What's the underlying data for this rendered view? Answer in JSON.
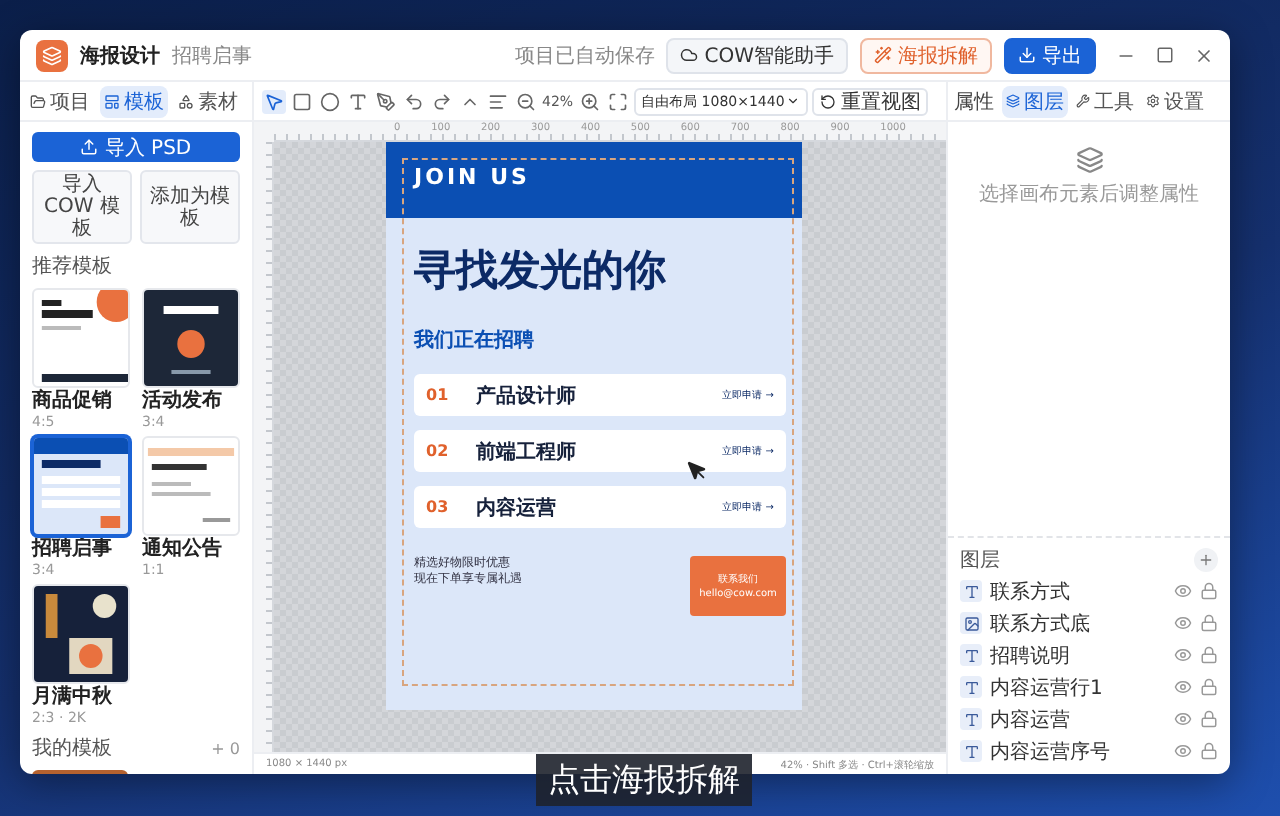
{
  "window": {
    "app_name": "海报设计",
    "document": "招聘启事",
    "save_status": "项目已自动保存",
    "actions": [
      {
        "label": "COW智能助手",
        "kind": "ghost"
      },
      {
        "label": "海报拆解",
        "kind": "accent"
      },
      {
        "label": "导出",
        "kind": "primary"
      }
    ]
  },
  "left_tabs": [
    {
      "label": "项目",
      "selected": false
    },
    {
      "label": "模板",
      "selected": true
    },
    {
      "label": "素材",
      "selected": false
    }
  ],
  "left_panel": {
    "import_button": "导入 PSD",
    "secondary_buttons": [
      "导入 COW 模板",
      "添加为模板"
    ],
    "section_title": "推荐模板",
    "templates": [
      {
        "name": "商品促销",
        "ratio": "4:5",
        "kind": "promo",
        "selected": false
      },
      {
        "name": "活动发布",
        "ratio": "3:4",
        "kind": "event",
        "selected": false
      },
      {
        "name": "招聘启事",
        "ratio": "3:4",
        "kind": "recruit",
        "selected": true
      },
      {
        "name": "通知公告",
        "ratio": "1:1",
        "kind": "notice",
        "selected": false
      },
      {
        "name": "月满中秋",
        "ratio": "2:3 · 2K",
        "kind": "festival",
        "selected": false
      }
    ],
    "my_section": {
      "title": "我的模板",
      "count": "+ 0"
    }
  },
  "toolbar": {
    "zoom": "42%",
    "layout_select": "自由布局 1080×1440",
    "reset_button": "重置视图"
  },
  "ruler_marks": [
    "0",
    "100",
    "200",
    "300",
    "400",
    "500",
    "600",
    "700",
    "800",
    "900",
    "1000"
  ],
  "poster": {
    "header": "JOIN US",
    "headline": "寻找发光的你",
    "subhead": "我们正在招聘",
    "jobs": [
      {
        "number": "01",
        "title": "产品设计师",
        "action": "立即申请 →"
      },
      {
        "number": "02",
        "title": "前端工程师",
        "action": "立即申请 →"
      },
      {
        "number": "03",
        "title": "内容运营",
        "action": "立即申请 →"
      }
    ],
    "note_lines": [
      "精选好物限时优惠",
      "现在下单享专属礼遇"
    ],
    "contact": {
      "title": "联系我们",
      "email": "hello@cow.com"
    }
  },
  "status_bar": {
    "size": "1080 × 1440 px",
    "hint": "42% · Shift 多选 · Ctrl+滚轮缩放"
  },
  "right_panel": {
    "title": "属性",
    "tabs": [
      {
        "label": "图层",
        "selected": true
      },
      {
        "label": "工具",
        "selected": false
      },
      {
        "label": "设置",
        "selected": false
      }
    ],
    "empty_hint": "选择画布元素后调整属性",
    "layers_title": "图层",
    "layers": [
      {
        "name": "联系方式",
        "kind": "text"
      },
      {
        "name": "联系方式底",
        "kind": "shape"
      },
      {
        "name": "招聘说明",
        "kind": "text"
      },
      {
        "name": "内容运营行1",
        "kind": "text"
      },
      {
        "name": "内容运营",
        "kind": "text"
      },
      {
        "name": "内容运营序号",
        "kind": "text"
      }
    ]
  },
  "caption": "点击海报拆解"
}
